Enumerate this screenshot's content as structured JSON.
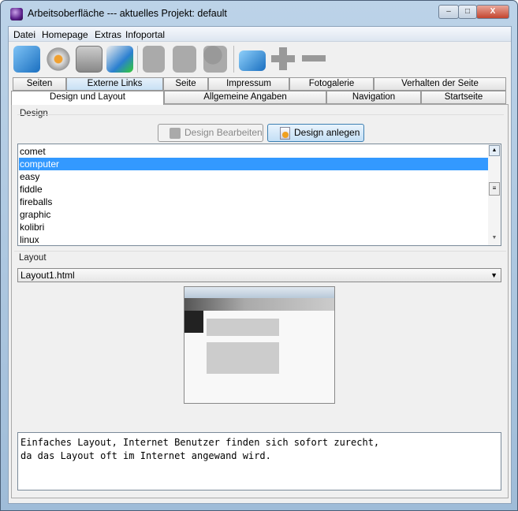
{
  "window": {
    "title": "Arbeitsoberfläche --- aktuelles Projekt: default",
    "min": "–",
    "max": "□",
    "close": "X"
  },
  "menu": [
    "Datei",
    "Homepage",
    "Extras",
    "Infoportal"
  ],
  "toolbar": [
    "database-icon",
    "settings-gear-icon",
    "config-icon",
    "refresh-icon",
    "copy-icon",
    "cut-icon",
    "paste-icon",
    "database-add-icon",
    "plus-icon",
    "minus-icon"
  ],
  "tabs_row1": [
    "Seiten",
    "Externe Links",
    "Seite",
    "Impressum",
    "Fotogalerie",
    "Verhalten der Seite"
  ],
  "tabs_row2": [
    "Design und Layout",
    "Allgemeine Angaben",
    "Navigation",
    "Startseite"
  ],
  "design": {
    "label": "Design",
    "edit_button": "Design Bearbeiten",
    "create_button": "Design anlegen",
    "items": [
      "comet",
      "computer",
      "easy",
      "fiddle",
      "fireballs",
      "graphic",
      "kolibri",
      "linux"
    ],
    "selected": "computer"
  },
  "layout": {
    "label": "Layout",
    "selected": "Layout1.html",
    "description": "Einfaches Layout, Internet Benutzer finden sich sofort zurecht,\nda das Layout oft im Internet angewand wird."
  },
  "colors": {
    "selection": "#3399ff"
  }
}
